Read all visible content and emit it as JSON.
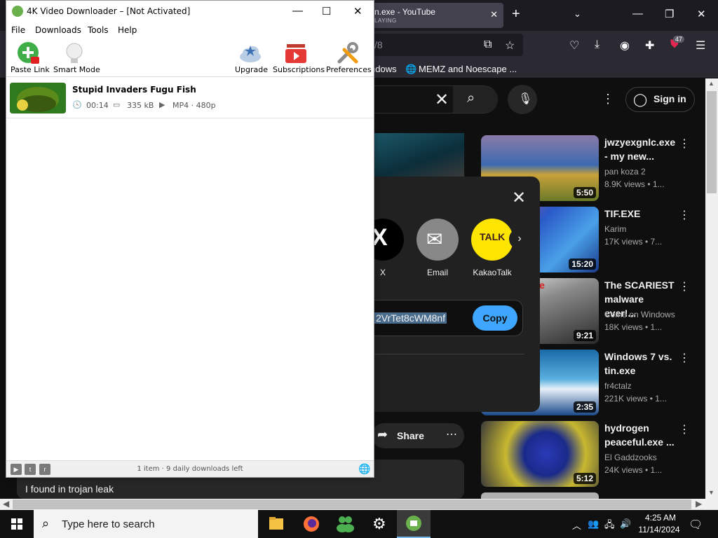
{
  "browser": {
    "tab_title": "n.exe - YouTube",
    "tab_subtitle": "LAYING",
    "url_fragment": "/8",
    "badge_count": "47",
    "bookmarks": [
      "ndows",
      "MEMZ and Noescape ..."
    ]
  },
  "youtube": {
    "sign_in": "Sign in",
    "share_dialog": {
      "targets": [
        {
          "label": "X",
          "icon": "x-logo-icon"
        },
        {
          "label": "Email",
          "icon": "email-icon"
        },
        {
          "label": "KakaoTalk",
          "icon": "kakaotalk-icon",
          "badge": "TALK"
        }
      ],
      "link_text": "2VrTet8cWM8nf",
      "copy_label": "Copy"
    },
    "share_label": "Share",
    "comment_text": "I found in trojan leak",
    "related": [
      {
        "title": "jwzyexgnlc.exe - my new...",
        "channel": "pan koza 2",
        "views": "8.9K views • 1...",
        "duration": "5:50"
      },
      {
        "title": "TIF.EXE",
        "channel": "Karim",
        "views": "17K views • 7...",
        "duration": "15:20"
      },
      {
        "title": "The SCARIEST malware ever!...",
        "channel": "Come on Windows",
        "views": "18K views • 1...",
        "duration": "9:21",
        "thumb_text": "la.exe"
      },
      {
        "title": "Windows 7 vs. tin.exe",
        "channel": "fr4ctalz",
        "views": "221K views • 1...",
        "duration": "2:35"
      },
      {
        "title": "hydrogen peaceful.exe ...",
        "channel": "El Gaddzooks",
        "views": "24K views • 1...",
        "duration": "5:12"
      }
    ]
  },
  "app": {
    "title": "4K Video Downloader – [Not Activated]",
    "menu": [
      "File",
      "Downloads",
      "Tools",
      "Help"
    ],
    "toolbar": {
      "paste_link": "Paste Link",
      "smart_mode": "Smart Mode",
      "upgrade": "Upgrade",
      "subscriptions": "Subscriptions",
      "preferences": "Preferences"
    },
    "downloads": [
      {
        "title": "Stupid Invaders Fugu Fish",
        "duration": "00:14",
        "size": "335 kB",
        "format": "MP4 · 480p"
      }
    ],
    "status": "1 item · 9 daily downloads left"
  },
  "taskbar": {
    "search_placeholder": "Type here to search",
    "time": "4:25 AM",
    "date": "11/14/2024"
  },
  "colors": {
    "yt_bg": "#0f0f0f",
    "copy_button": "#3ea6ff",
    "kakao_yellow": "#fee500",
    "app_green": "#6ab04c",
    "taskbar": "#101010"
  }
}
